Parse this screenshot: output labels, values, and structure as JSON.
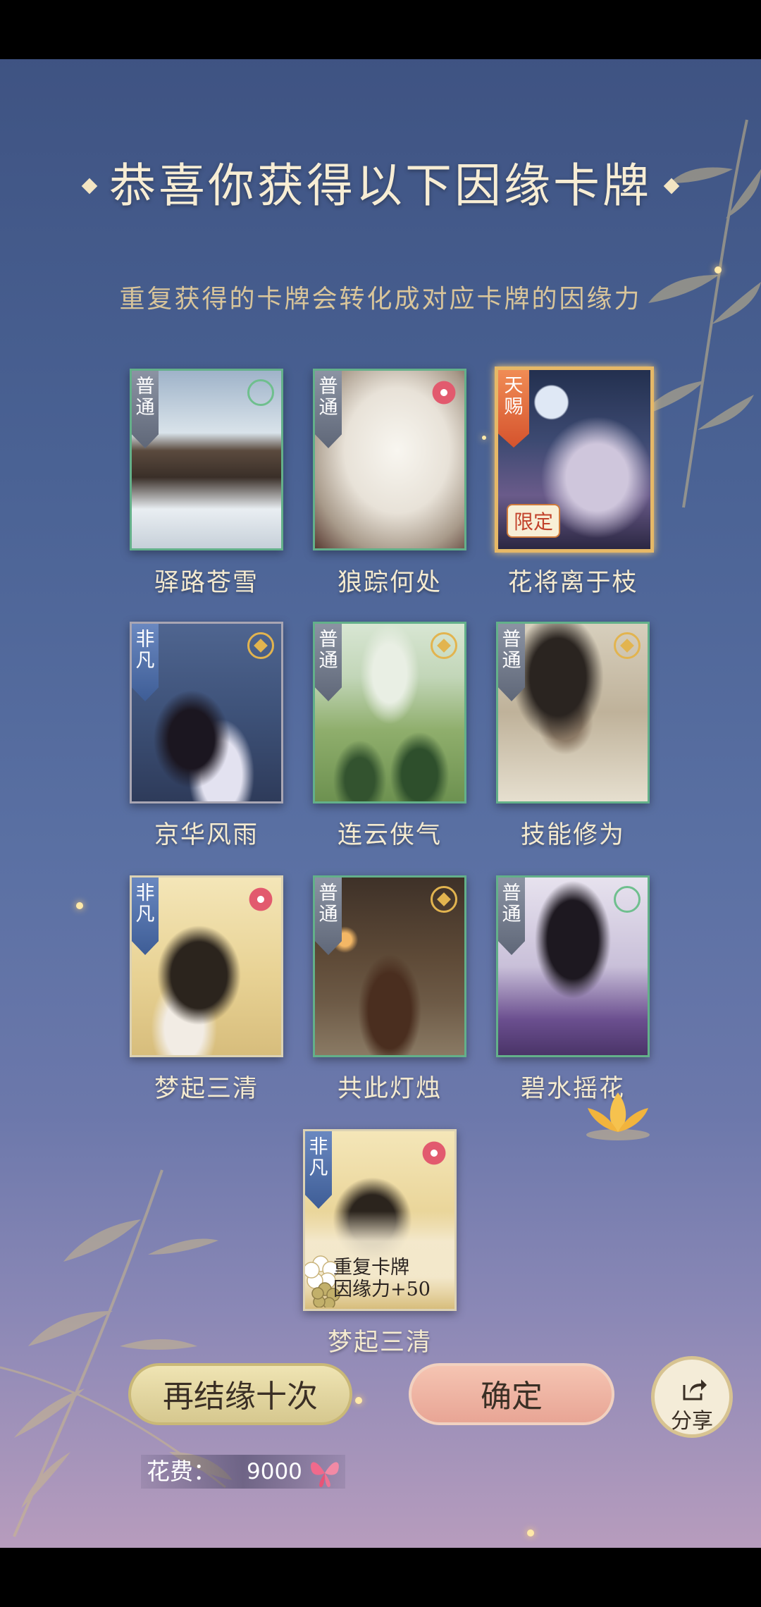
{
  "header": {
    "title": "恭喜你获得以下因缘卡牌",
    "subtitle": "重复获得的卡牌会转化成对应卡牌的因缘力"
  },
  "cards": [
    {
      "name": "驿路苍雪",
      "rank": "普通",
      "emblem": "green-emblem"
    },
    {
      "name": "狼踪何处",
      "rank": "普通",
      "emblem": "flower-emblem"
    },
    {
      "name": "花将离于枝",
      "rank": "天赐",
      "tag": "限定"
    },
    {
      "name": "京华风雨",
      "rank": "非凡",
      "emblem": "gold-emblem"
    },
    {
      "name": "连云侠气",
      "rank": "普通",
      "emblem": "gold-emblem"
    },
    {
      "name": "技能修为",
      "rank": "普通",
      "emblem": "gold-emblem"
    },
    {
      "name": "梦起三清",
      "rank": "非凡",
      "emblem": "flower-emblem"
    },
    {
      "name": "共此灯烛",
      "rank": "普通",
      "emblem": "gold-emblem"
    },
    {
      "name": "碧水摇花",
      "rank": "普通",
      "emblem": "green-emblem"
    },
    {
      "name": "梦起三清",
      "rank": "非凡",
      "emblem": "flower-emblem",
      "duplicate_line1": "重复卡牌",
      "duplicate_line2": "因缘力+50"
    }
  ],
  "buttons": {
    "again": "再结缘十次",
    "confirm": "确定",
    "share": "分享"
  },
  "cost": {
    "label": "花费：",
    "value": "9000",
    "icon": "butterfly-icon"
  },
  "colors": {
    "background_top": "#3d5180",
    "background_bottom": "#b79cbd",
    "title": "#f7edd4",
    "subtitle": "#d9c59a",
    "card_border_green": "#63b08a",
    "card_border_gold": "#e6b867"
  }
}
